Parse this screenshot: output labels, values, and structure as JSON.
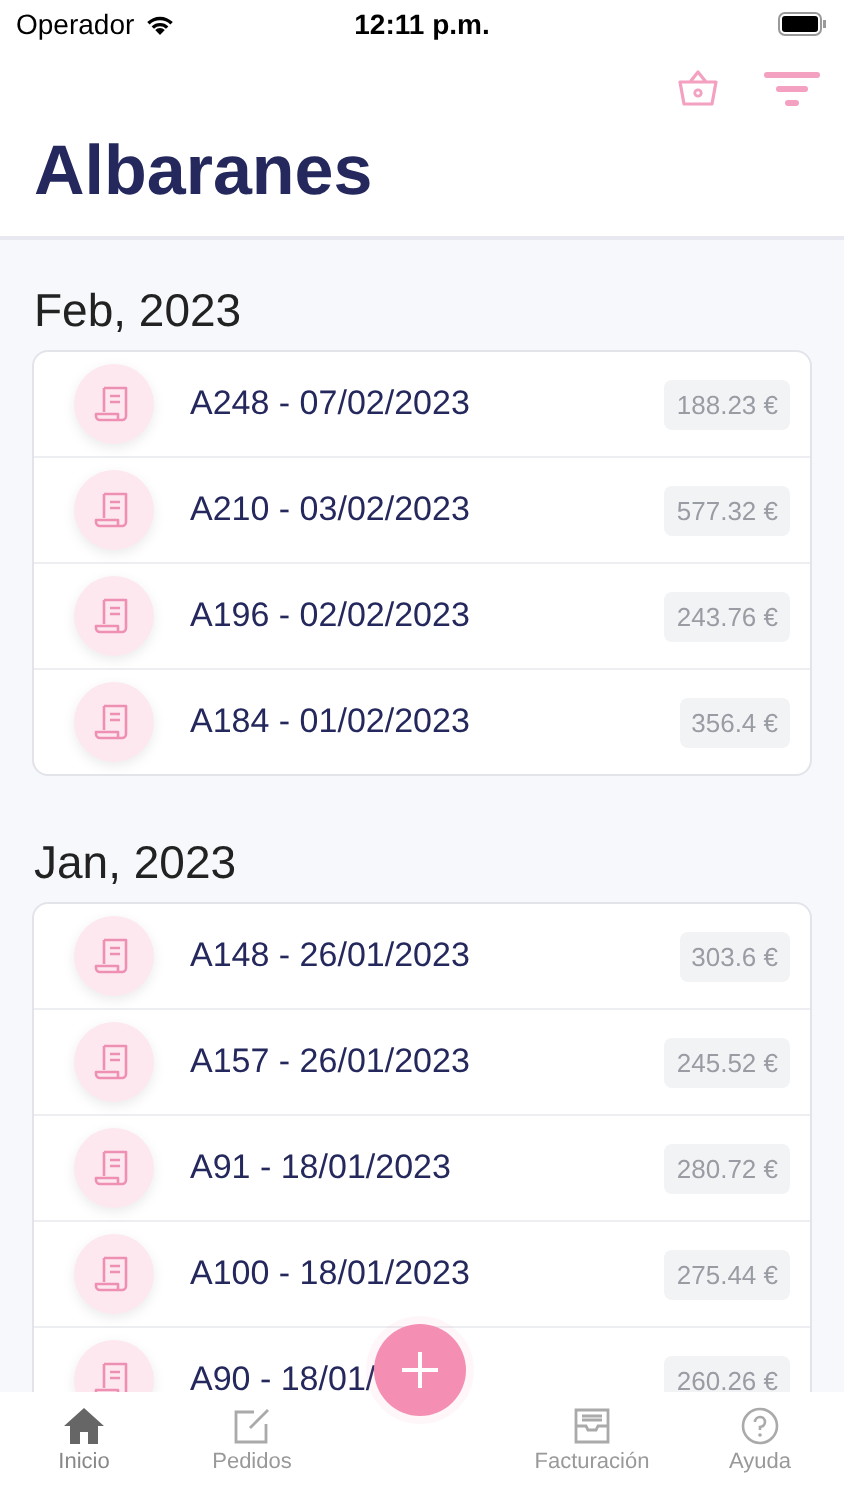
{
  "status_bar": {
    "carrier": "Operador",
    "time": "12:11 p.m."
  },
  "title": "Albaranes",
  "sections": [
    {
      "heading": "Feb, 2023",
      "rows": [
        {
          "label": "A248 - 07/02/2023",
          "amount": "188.23 €"
        },
        {
          "label": "A210 - 03/02/2023",
          "amount": "577.32 €"
        },
        {
          "label": "A196 - 02/02/2023",
          "amount": "243.76 €"
        },
        {
          "label": "A184 - 01/02/2023",
          "amount": "356.4 €"
        }
      ]
    },
    {
      "heading": "Jan, 2023",
      "rows": [
        {
          "label": "A148 - 26/01/2023",
          "amount": "303.6 €"
        },
        {
          "label": "A157 - 26/01/2023",
          "amount": "245.52 €"
        },
        {
          "label": "A91 - 18/01/2023",
          "amount": "280.72 €"
        },
        {
          "label": "A100 - 18/01/2023",
          "amount": "275.44 €"
        },
        {
          "label": "A90 - 18/01/",
          "amount": "260.26 €"
        }
      ]
    }
  ],
  "tab_bar": [
    {
      "label": "Inicio",
      "selected": true
    },
    {
      "label": "Pedidos",
      "selected": false
    },
    {
      "label": "Facturación",
      "selected": false
    },
    {
      "label": "Ayuda",
      "selected": false
    }
  ]
}
